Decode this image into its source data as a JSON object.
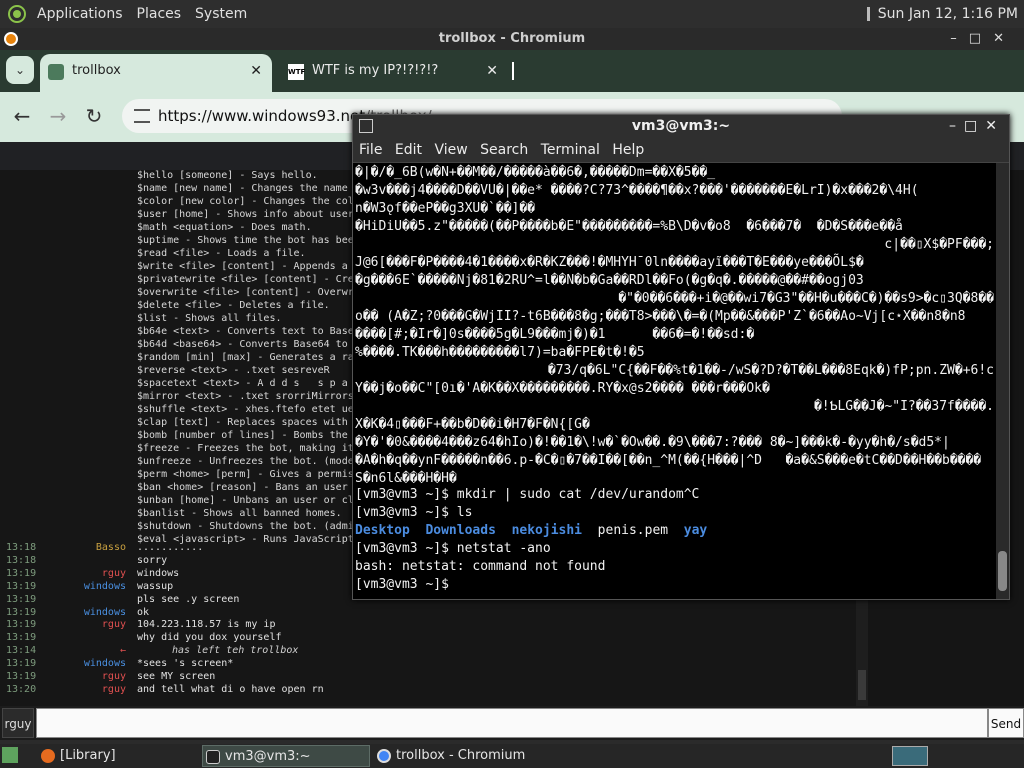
{
  "top_panel": {
    "menus": [
      "Applications",
      "Places",
      "System"
    ],
    "clock": "Sun Jan 12,  1:16 PM"
  },
  "chrome": {
    "window_title": "trollbox - Chromium",
    "tabs": [
      {
        "label": "trollbox",
        "favicon": "trollbox-favicon"
      },
      {
        "label": "WTF is my IP?!?!?!?",
        "favicon_text": "WTF"
      }
    ],
    "url_host": "https://www.windows93.net",
    "url_path": "/trollbox/"
  },
  "trollbox": {
    "help_lines": [
      "$hello [someone] - Says hello.",
      "$name [new name] - Changes the name",
      "$color [new color] - Changes the col",
      "$user [home] - Shows info about user",
      "$math <equation> - Does math.",
      "$uptime - Shows time the bot has bee",
      "$read <file> - Loads a file.",
      "$write <file> [content] - Appends a",
      "$privatewrite <file> [content] - Cre",
      "$overwrite <file> [content] - Overwr",
      "$delete <file> - Deletes a file.",
      "$list - Shows all files.",
      "$b64e <text> - Converts text to Base",
      "$b64d <base64> - Converts Base64 to",
      "$random [min] [max] - Generates a ra",
      "$reverse <text> - .txet sesreveR",
      "$spacetext <text> - A d d s   s p a",
      "$mirror <text> - .txet srorriMirrors",
      "$shuffle <text> - xhes.ftefo etet ue",
      "$clap [text] - Replaces spaces with",
      "$bomb [number of lines] - Bombs the",
      "$freeze - Freezes the bot, making it",
      "$unfreeze - Unfreezes the bot. (mode",
      "$perm <home> [perm] - Gives a permis",
      "$ban <home> [reason] - Bans an user",
      "$unban [home] - Unbans an user or cl",
      "$banlist - Shows all banned homes.",
      "$shutdown - Shutdowns the bot. (admi",
      "$eval <javascript> - Runs JavaScript"
    ],
    "messages": [
      {
        "time": "13:18",
        "nick": "Basso",
        "nick_color": "#c8a040",
        "text": "..........."
      },
      {
        "time": "13:18",
        "nick": "",
        "nick_color": "#ffffff",
        "text": "sorry"
      },
      {
        "time": "13:19",
        "nick": "rguy",
        "nick_color": "#e05050",
        "text": "windows"
      },
      {
        "time": "13:19",
        "nick": "windows",
        "nick_color": "#4a90e2",
        "text": "wassup"
      },
      {
        "time": "13:19",
        "nick": "",
        "nick_color": "#ffffff",
        "text": "pls see .y screen"
      },
      {
        "time": "13:19",
        "nick": "windows",
        "nick_color": "#4a90e2",
        "text": "ok"
      },
      {
        "time": "13:19",
        "nick": "rguy",
        "nick_color": "#e05050",
        "text": "104.223.118.57 is my ip"
      },
      {
        "time": "13:19",
        "nick": "",
        "nick_color": "#ffffff",
        "text": "why did you dox yourself"
      },
      {
        "time": "13:14",
        "nick": "←",
        "nick_color": "#e05050",
        "text": "has left teh trollbox",
        "italic": true
      },
      {
        "time": "13:19",
        "nick": "windows",
        "nick_color": "#4a90e2",
        "text": "*sees 's screen*"
      },
      {
        "time": "13:19",
        "nick": "rguy",
        "nick_color": "#e05050",
        "text": "see MY screen"
      },
      {
        "time": "13:20",
        "nick": "rguy",
        "nick_color": "#e05050",
        "text": "and tell what di o have open rn"
      }
    ],
    "nick_box": "rguy",
    "input_value": "",
    "send_label": "Send"
  },
  "terminal": {
    "title": "vm3@vm3:~",
    "menu": [
      "File",
      "Edit",
      "View",
      "Search",
      "Terminal",
      "Help"
    ],
    "garbage_lines": [
      {
        "text": "�|�/�_6B(w�N+��M��/�����à��6�,�����Dm=��X�5��_",
        "align": "left"
      },
      {
        "text": "�w3v���j4����D��VU�|��e* ����?C?73^����¶��x?���'�������E�LrI)�x���2�\\4H(",
        "align": "left"
      },
      {
        "text": "n�W3ǫf��eP��g3XU�`��]��",
        "align": "left"
      },
      {
        "text": "�HiDiU��5.z\"�����(��P����b�E\"���������=%B\\D�v�o8  �6���7�  �D�S���e��å",
        "align": "left"
      },
      {
        "text": "c|��▯X$�PF���;",
        "align": "right"
      },
      {
        "text": "J@6[���F�P����4�1����x�R�KZ���!�MHYHˉ0ln����ayĩ���T�E���ye���ÕL$�",
        "align": "left"
      },
      {
        "text": "�g���6E`�����Nj�81�2RU^=l��N�b�Ga��RDl��Fo(�g�q�.�����@��#��ogj03",
        "align": "left"
      },
      {
        "text": "�\"�0��6���+i�@��wi7�G3\"��H�u���C�)��s9>�c▯3Q�8��",
        "align": "right"
      },
      {
        "text": "o�� (A�Z;?0���G�WjII?-t6B���8�g;���T8>���\\�=�(Mp��&���P'Z`�6��Ao~Vj[c⋆X��n8�n8",
        "align": "left"
      },
      {
        "text": "����[#;�Ir�]0s����5g�L9���mj�)�1      ��6�=�!��sd:�",
        "align": "left"
      },
      {
        "text": "%����.TK���h���������l7)=ba�FPE�t�!�5",
        "align": "left"
      },
      {
        "text": "�73/q�6L\"C{��F��%t�1��-/wS�?D?�T��L���8Eqk�)fP;pn.ZW�+6!c",
        "align": "right"
      },
      {
        "text": "Y��j�o��C\"[0ı�'A�K��X���������.RY�x@s2���� ���r���Ok�",
        "align": "left"
      },
      {
        "text": "�!ƄLG��J�~\"I?��37f����.",
        "align": "right"
      },
      {
        "text": "X�K�4▯���F+��b�D��i�H7�F�N{[G�",
        "align": "left"
      },
      {
        "text": "�Y�'�0&����4���z64�hIo)�!��1�\\!w�`�Ow��.�9\\���7:?��� 8�~]���k�-�yy�h�/s�d5*|",
        "align": "left"
      },
      {
        "text": "�A�h�q��ynF�����n��6.p-�C�▯�7��I��[��n_^M(��{H���|^D   �a�&S���e�tC��D��H��b����",
        "align": "left"
      },
      {
        "text": "S�n6l&���H�H�",
        "align": "left"
      }
    ],
    "prompt1": "[vm3@vm3 ~]$ mkdir | sudo cat /dev/urandom^C",
    "prompt2": "[vm3@vm3 ~]$ ls",
    "ls_dirs": [
      "Desktop",
      "Downloads",
      "nekojishi"
    ],
    "ls_file": "penis.pem",
    "ls_dir_last": "yay",
    "prompt3": "[vm3@vm3 ~]$ netstat -ano",
    "error_line": "bash: netstat: command not found",
    "prompt4": "[vm3@vm3 ~]$ "
  },
  "taskbar": {
    "items": [
      {
        "label": "[Library]",
        "icon": "firefox-icon"
      },
      {
        "label": "vm3@vm3:~",
        "icon": "terminal-icon"
      },
      {
        "label": "trollbox - Chromium",
        "icon": "chromium-icon"
      }
    ]
  }
}
